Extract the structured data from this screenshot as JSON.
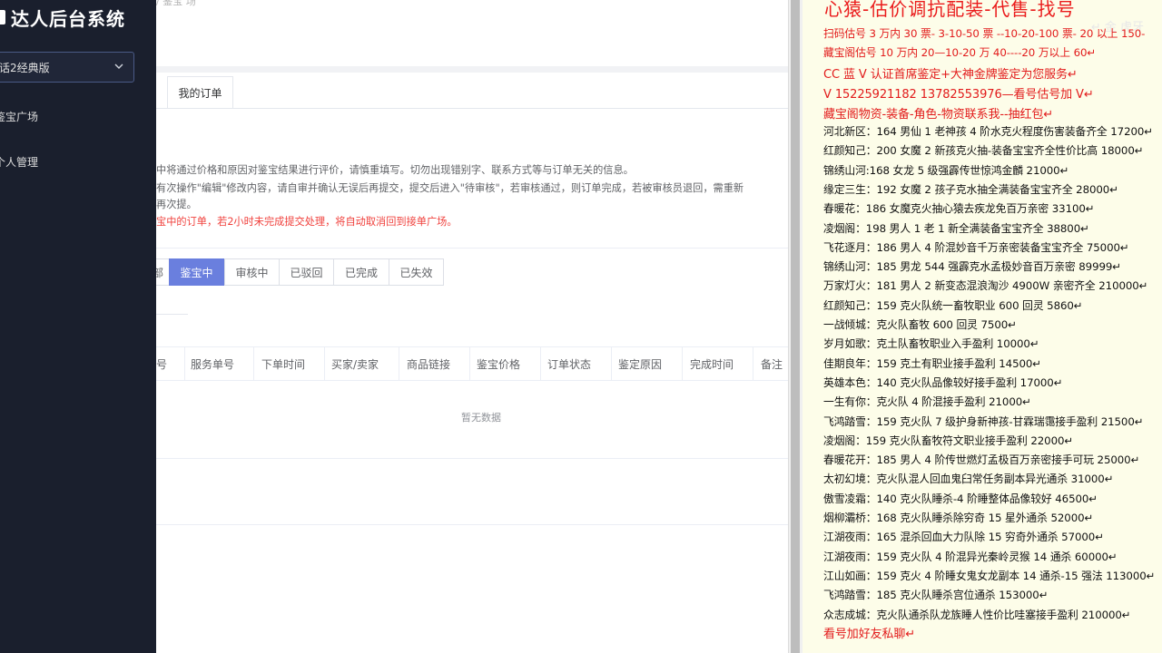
{
  "sidebar": {
    "brand_title": "达人后台系统",
    "version_select": "话2经典版",
    "nav": [
      {
        "label": "鉴宝广场"
      },
      {
        "label": "个人管理"
      }
    ]
  },
  "breadcrumb": {
    "text": "/  鉴宝  场"
  },
  "tabs": {
    "my_orders": "我的订单"
  },
  "notices": [
    "中将通过价格和原因对鉴宝结果进行评价，请慎重填写。切勿出现错别字、联系方式等与订单无关的信息。",
    "有次操作\"编辑\"修改内容，请自审并确认无误后再提交，提交后进入\"待审核\"，若审核通过，则订单完成，若被审核员退回，需重新",
    "再次提。",
    "宝中的订单，若2小时未完成提交处理，将自动取消回到接单广场。"
  ],
  "filters": [
    {
      "label": "部",
      "active": false
    },
    {
      "label": "鉴宝中",
      "active": true
    },
    {
      "label": "审核中",
      "active": false
    },
    {
      "label": "已驳回",
      "active": false
    },
    {
      "label": "已完成",
      "active": false
    },
    {
      "label": "已失效",
      "active": false
    }
  ],
  "table": {
    "headers": [
      "号",
      "服务单号",
      "下单时间",
      "买家/卖家",
      "商品链接",
      "鉴宝价格",
      "订单状态",
      "鉴定原因",
      "完成时间",
      "备注"
    ],
    "empty_text": "暂无数据"
  },
  "panel": {
    "header": "心猿-估价调抗配装-代售-找号",
    "watermark": "↵ 金 虎牙",
    "lines": [
      {
        "text": "扫码估号 3 万内 30 票- 3-10-50 票  --10-20-100 票- 20 以上 150-",
        "red": true
      },
      {
        "text": "藏宝阁估号 10 万内 20—10-20 万 40----20 万以上 60↵",
        "red": true
      },
      {
        "text": "CC 蓝 V 认证首席鉴定+大神金牌鉴定为您服务↵",
        "red": true,
        "big": true
      },
      {
        "text": "V 15225921182      13782553976—看号估号加 V↵",
        "red": true,
        "big": true
      },
      {
        "text": "藏宝阁物资-装备-角色-物资联系我--抽红包↵",
        "red": true,
        "big": true
      },
      {
        "text": "河北新区：164 男仙 1 老神孩 4 阶水克火程度伤害装备齐全 17200↵"
      },
      {
        "text": "红颜知己：200 女魔 2 新孩克火抽-装备宝宝齐全性价比高 18000↵"
      },
      {
        "text": "锦绣山河:168 女龙 5 级强霹传世惊鸿金麟 21000↵"
      },
      {
        "text": "缘定三生：192 女魔 2 孩子克水抽全满装备宝宝齐全 28000↵"
      },
      {
        "text": "春暖花：186 女魔克火抽心猿去疾龙免百万亲密 33100↵"
      },
      {
        "text": "凌烟阁：198 男人 1 老 1 新全满装备宝宝齐全 38800↵"
      },
      {
        "text": "飞花逐月：186 男人 4 阶混妙音千万亲密装备宝宝齐全 75000↵"
      },
      {
        "text": "锦绣山河：185 男龙 544 强霹克水孟极妙音百万亲密 89999↵"
      },
      {
        "text": "万家灯火：181 男人 2 新变态混浪淘沙 4900W 亲密齐全 210000↵"
      },
      {
        "text": "红颜知己：159 克火队统一畜牧职业 600 回灵 5860↵"
      },
      {
        "text": "一战倾城：克火队畜牧 600 回灵 7500↵"
      },
      {
        "text": "岁月如歌：克土队畜牧职业入手盈利 10000↵"
      },
      {
        "text": "佳期良年：159 克土有职业接手盈利 14500↵"
      },
      {
        "text": "英雄本色：140 克火队品像较好接手盈利 17000↵"
      },
      {
        "text": "一生有你：克火队 4 阶混接手盈利 21000↵"
      },
      {
        "text": "飞鸿踏雪：159 克火队 7 级护身新神孩-甘霖瑞霭接手盈利 21500↵"
      },
      {
        "text": "凌烟阁：159 克火队畜牧符文职业接手盈利 22000↵"
      },
      {
        "text": "春暖花开：185 男人 4 阶传世燃灯孟极百万亲密接手可玩 25000↵"
      },
      {
        "text": "太初幻境：克火队混人回血鬼臼常任务副本异光通杀 31000↵"
      },
      {
        "text": "傲雪凌霜：140 克火队睡杀-4 阶睡整体品像较好 46500↵"
      },
      {
        "text": "烟柳灞桥：168 克火队睡杀除穷奇 15 星外通杀 52000↵"
      },
      {
        "text": "江湖夜雨：165 混杀回血大力队除 15 穷奇外通杀 57000↵"
      },
      {
        "text": "江湖夜雨：159 克火队 4 阶混异光秦岭灵猴 14 通杀 60000↵"
      },
      {
        "text": "江山如画：159 克火 4 阶睡女鬼女龙副本 14 通杀-15 强法 113000↵"
      },
      {
        "text": "飞鸿踏雪：185 克火队睡杀宫位通杀 153000↵"
      },
      {
        "text": "众志成城：克火队通杀队龙族睡人性价比哇塞接手盈利 210000↵"
      },
      {
        "text": "看号加好友私聊↵",
        "red": true,
        "big": true
      }
    ]
  },
  "colors": {
    "sidebar_bg": "#1a1f2d",
    "accent": "#6a7fde",
    "panel_bg": "#fdfde9",
    "panel_red": "#e21b1b"
  }
}
